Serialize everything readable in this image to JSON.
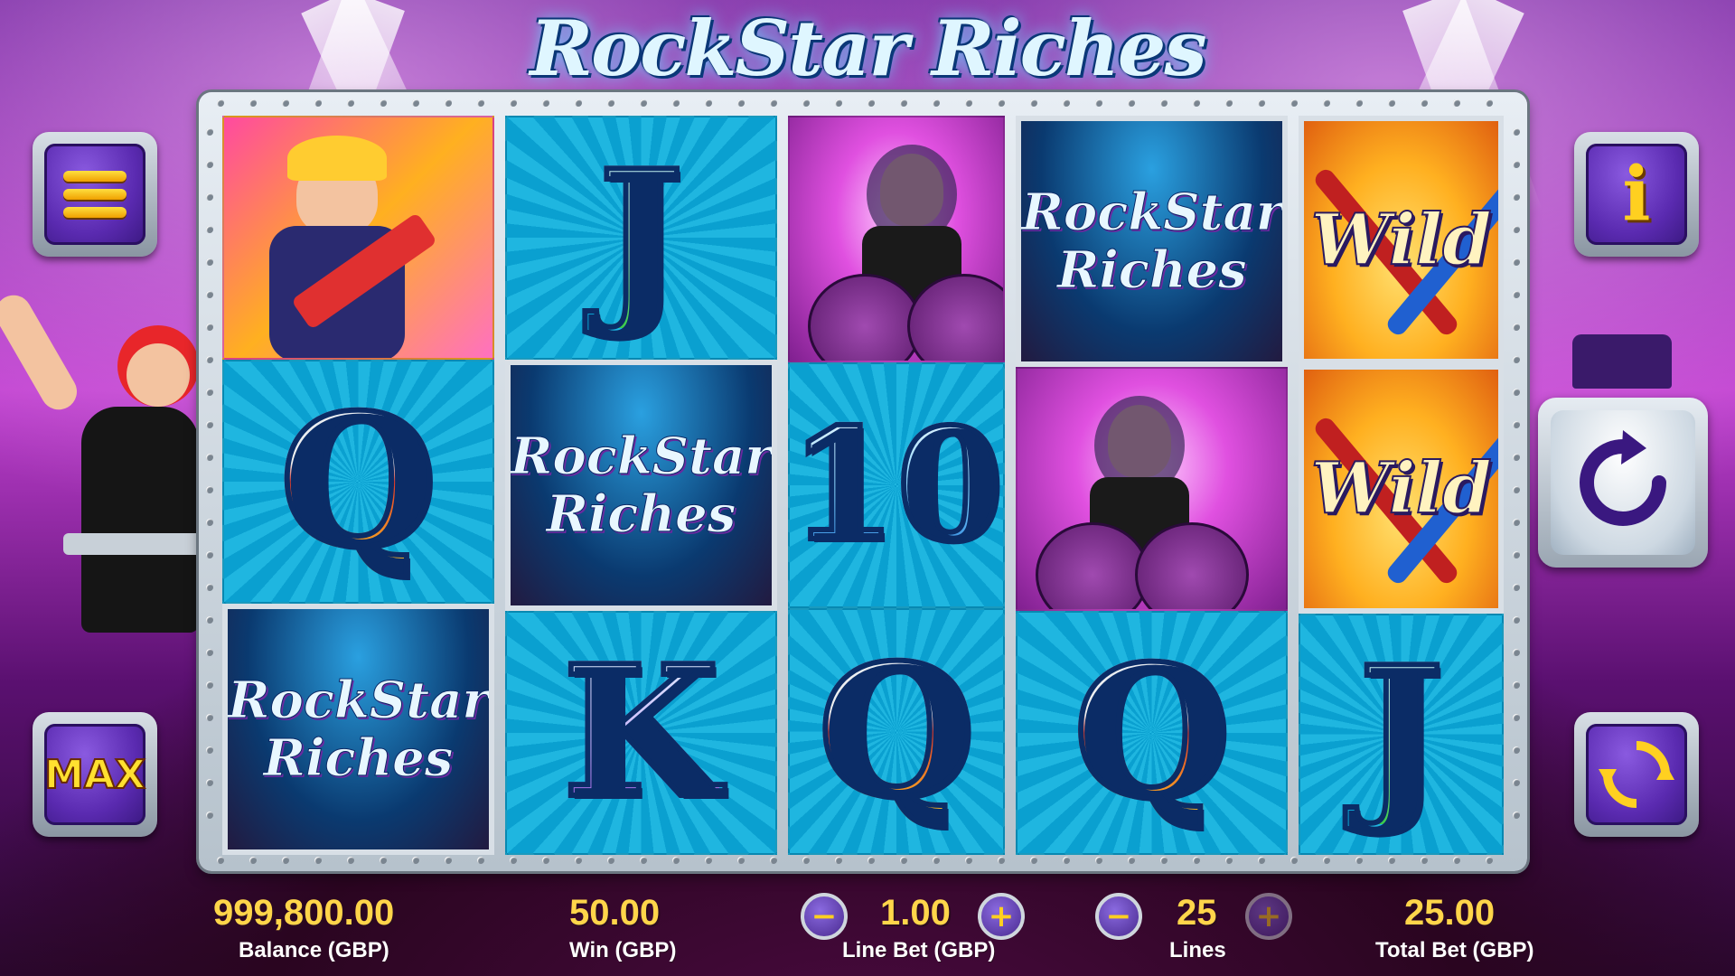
{
  "game": {
    "title": "RockStar Riches"
  },
  "reels": [
    [
      {
        "symbol": "guitarist-rocker"
      },
      {
        "symbol": "Q"
      },
      {
        "symbol": "rockstar-riches-logo",
        "text_line1": "RockStar",
        "text_line2": "Riches"
      }
    ],
    [
      {
        "symbol": "J"
      },
      {
        "symbol": "rockstar-riches-logo",
        "text_line1": "RockStar",
        "text_line2": "Riches"
      },
      {
        "symbol": "K"
      }
    ],
    [
      {
        "symbol": "drummer"
      },
      {
        "symbol": "10"
      },
      {
        "symbol": "Q"
      }
    ],
    [
      {
        "symbol": "rockstar-riches-logo",
        "text_line1": "RockStar",
        "text_line2": "Riches"
      },
      {
        "symbol": "drummer"
      },
      {
        "symbol": "Q"
      }
    ],
    [
      {
        "symbol": "wild",
        "text": "Wild"
      },
      {
        "symbol": "wild",
        "text": "Wild"
      },
      {
        "symbol": "J"
      }
    ]
  ],
  "letters": {
    "J": "J",
    "Q": "Q",
    "K": "K",
    "ten": "10"
  },
  "buttons": {
    "menu_icon": "hamburger-menu-icon",
    "info_glyph": "i",
    "max_label": "MAX",
    "spin_icon": "spin-arrow-icon",
    "autoplay_icon": "autoplay-icon",
    "minus": "−",
    "plus": "+"
  },
  "bottom_bar": {
    "balance_value": "999,800.00",
    "balance_label": "Balance (GBP)",
    "win_value": "50.00",
    "win_label": "Win (GBP)",
    "line_bet_value": "1.00",
    "line_bet_label": "Line Bet (GBP)",
    "lines_value": "25",
    "lines_label": "Lines",
    "total_bet_value": "25.00",
    "total_bet_label": "Total Bet (GBP)"
  },
  "colors": {
    "value_gold": "#ffd54a",
    "button_purple": "#5a2ab0",
    "reel_cyan": "#1fb6e0"
  }
}
